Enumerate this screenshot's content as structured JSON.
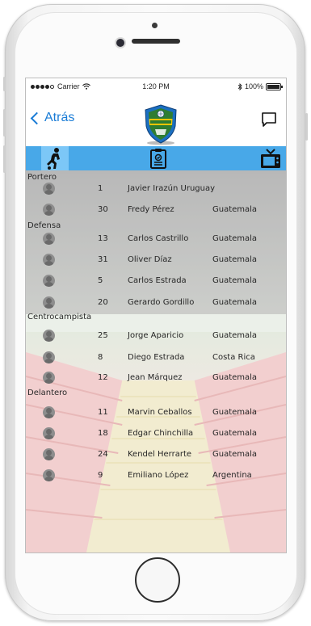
{
  "status_bar": {
    "carrier": "Carrier",
    "time": "1:20 PM",
    "battery": "100%"
  },
  "nav": {
    "back_label": "Atrás"
  },
  "tabs": [
    {
      "icon": "soccer-player-icon",
      "active": true
    },
    {
      "icon": "clipboard-icon",
      "active": false
    },
    {
      "icon": "tv-icon",
      "active": false
    }
  ],
  "roster": {
    "sections": {
      "portero": "Portero",
      "defensa": "Defensa",
      "centrocampista": "Centrocampista",
      "delantero": "Delantero"
    },
    "players": [
      {
        "number": "1",
        "name": "Javier Irazún Uruguay",
        "country": ""
      },
      {
        "number": "30",
        "name": "Fredy Pérez",
        "country": "Guatemala"
      },
      {
        "number": "13",
        "name": "Carlos Castrillo",
        "country": "Guatemala"
      },
      {
        "number": "31",
        "name": "Oliver Díaz",
        "country": "Guatemala"
      },
      {
        "number": "5",
        "name": "Carlos Estrada",
        "country": "Guatemala"
      },
      {
        "number": "20",
        "name": "Gerardo Gordillo",
        "country": "Guatemala"
      },
      {
        "number": "25",
        "name": "Jorge Aparicio",
        "country": "Guatemala"
      },
      {
        "number": "8",
        "name": "Diego Estrada",
        "country": "Costa Rica"
      },
      {
        "number": "12",
        "name": "Jean Márquez",
        "country": "Guatemala"
      },
      {
        "number": "11",
        "name": "Marvin Ceballos",
        "country": "Guatemala"
      },
      {
        "number": "18",
        "name": "Edgar Chinchilla",
        "country": "Guatemala"
      },
      {
        "number": "24",
        "name": "Kendel Herrarte",
        "country": "Guatemala"
      },
      {
        "number": "9",
        "name": "Emiliano López",
        "country": "Argentina"
      }
    ]
  },
  "colors": {
    "accent": "#1a7cd6",
    "tabbar": "#48a8e8",
    "tab_active": "#7cc7f7",
    "club_green": "#2e7d32",
    "club_blue": "#1b6fc2"
  }
}
